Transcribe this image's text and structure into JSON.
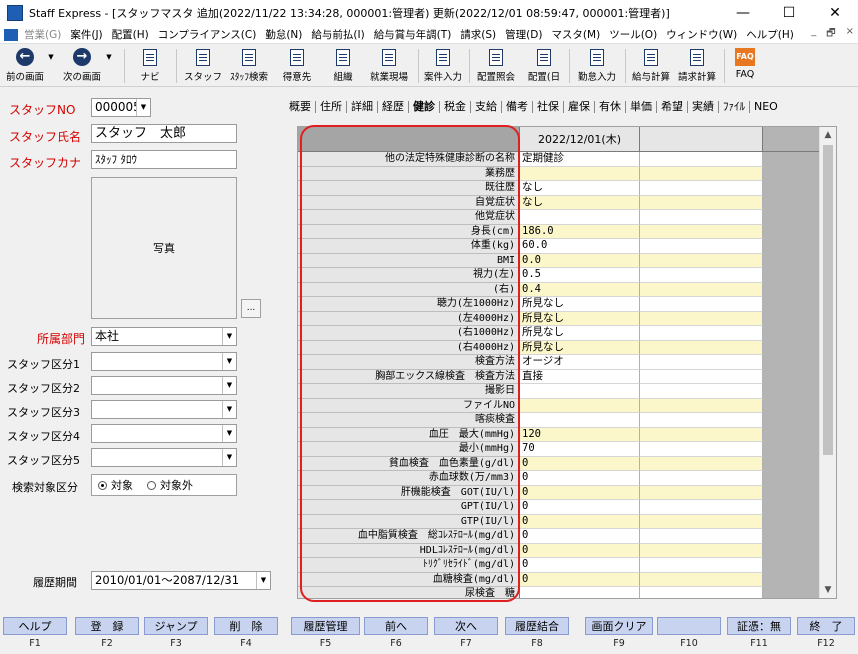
{
  "window": {
    "title": "Staff Express - [スタッフマスタ 追加(2022/11/22 13:34:28, 000001:管理者) 更新(2022/12/01 08:59:47, 000001:管理者)]",
    "minimize": "—",
    "maximize": "☐",
    "close": "✕"
  },
  "menu": [
    {
      "label": "営業(G)",
      "dim": true
    },
    {
      "label": "案件(J)",
      "dim": false
    },
    {
      "label": "配置(H)",
      "dim": false
    },
    {
      "label": "コンプライアンス(C)",
      "dim": false
    },
    {
      "label": "勤怠(N)",
      "dim": false
    },
    {
      "label": "給与前払(I)",
      "dim": false
    },
    {
      "label": "給与賞与年調(T)",
      "dim": false
    },
    {
      "label": "請求(S)",
      "dim": false
    },
    {
      "label": "管理(D)",
      "dim": false
    },
    {
      "label": "マスタ(M)",
      "dim": false
    },
    {
      "label": "ツール(O)",
      "dim": false
    },
    {
      "label": "ウィンドウ(W)",
      "dim": false
    },
    {
      "label": "ヘルプ(H)",
      "dim": false
    }
  ],
  "mdi_controls": [
    "_",
    "🗗",
    "×"
  ],
  "toolbar": [
    {
      "label": "前の画面",
      "icon": "back-arrow-icon"
    },
    {
      "label": "次の画面",
      "icon": "forward-arrow-icon"
    },
    {
      "label": "ナビ",
      "icon": "navi-icon"
    },
    {
      "label": "スタッフ",
      "icon": "staff-icon"
    },
    {
      "label": "ｽﾀｯﾌ検索",
      "icon": "staff-search-icon"
    },
    {
      "label": "得意先",
      "icon": "customer-icon"
    },
    {
      "label": "組織",
      "icon": "organization-icon"
    },
    {
      "label": "就業現場",
      "icon": "worksite-icon"
    },
    {
      "label": "案件入力",
      "icon": "project-input-icon"
    },
    {
      "label": "配置照会",
      "icon": "placement-inquiry-icon"
    },
    {
      "label": "配置(日",
      "icon": "placement-daily-icon"
    },
    {
      "label": "勤怠入力",
      "icon": "attendance-input-icon"
    },
    {
      "label": "給与計算",
      "icon": "payroll-calc-icon"
    },
    {
      "label": "請求計算",
      "icon": "billing-calc-icon"
    },
    {
      "label": "FAQ",
      "icon": "faq-icon"
    }
  ],
  "left": {
    "staff_no_label": "スタッフNO",
    "staff_no_value": "000005",
    "staff_name_label": "スタッフ氏名",
    "staff_name_value": "スタッフ　太郎",
    "staff_kana_label": "スタッフカナ",
    "staff_kana_value": "ｽﾀｯﾌ ﾀﾛｳ",
    "photo_label": "写真",
    "photo_button": "...",
    "dept_label": "所属部門",
    "dept_value": "本社",
    "class1_label": "スタッフ区分1",
    "class2_label": "スタッフ区分2",
    "class3_label": "スタッフ区分3",
    "class4_label": "スタッフ区分4",
    "class5_label": "スタッフ区分5",
    "search_label": "検索対象区分",
    "radio_on": "対象",
    "radio_off": "対象外",
    "history_label": "履歴期間",
    "history_value": "2010/01/01～2087/12/31"
  },
  "tabs": [
    "概要",
    "住所",
    "詳細",
    "経歴",
    "健診",
    "税金",
    "支給",
    "備考",
    "社保",
    "雇保",
    "有休",
    "単価",
    "希望",
    "実績",
    "ﾌｧｲﾙ",
    "NEO"
  ],
  "active_tab": "健診",
  "grid": {
    "column_date": "2022/12/01(木)",
    "rows": [
      {
        "label": "他の法定特殊健康診断の名称",
        "value": "定期健診"
      },
      {
        "label": "業務歴",
        "value": ""
      },
      {
        "label": "既往歴",
        "value": "なし"
      },
      {
        "label": "自覚症状",
        "value": "なし"
      },
      {
        "label": "他覚症状",
        "value": ""
      },
      {
        "label": "身長(cm)",
        "value": "186.0"
      },
      {
        "label": "体重(kg)",
        "value": "60.0"
      },
      {
        "label": "BMI",
        "value": "0.0"
      },
      {
        "label": "視力(左)",
        "value": "0.5"
      },
      {
        "label": "(右)",
        "value": "0.4"
      },
      {
        "label": "聴力(左1000Hz)",
        "value": "所見なし"
      },
      {
        "label": "(左4000Hz)",
        "value": "所見なし"
      },
      {
        "label": "(右1000Hz)",
        "value": "所見なし"
      },
      {
        "label": "(右4000Hz)",
        "value": "所見なし"
      },
      {
        "label": "検査方法",
        "value": "オージオ"
      },
      {
        "label": "胸部エックス線検査　検査方法",
        "value": "直接"
      },
      {
        "label": "撮影日",
        "value": ""
      },
      {
        "label": "ファイルNO",
        "value": ""
      },
      {
        "label": "喀痰検査",
        "value": ""
      },
      {
        "label": "血圧　最大(mmHg)",
        "value": "120"
      },
      {
        "label": "最小(mmHg)",
        "value": "70"
      },
      {
        "label": "貧血検査　血色素量(g/dl)",
        "value": "0"
      },
      {
        "label": "赤血球数(万/mm3)",
        "value": "0"
      },
      {
        "label": "肝機能検査　GOT(IU/l)",
        "value": "0"
      },
      {
        "label": "GPT(IU/l)",
        "value": "0"
      },
      {
        "label": "GTP(IU/l)",
        "value": "0"
      },
      {
        "label": "血中脂質検査　総ｺﾚｽﾃﾛｰﾙ(mg/dl)",
        "value": "0"
      },
      {
        "label": "HDLｺﾚｽﾃﾛｰﾙ(mg/dl)",
        "value": "0"
      },
      {
        "label": "ﾄﾘｸﾞﾘｾﾗｲﾄﾞ(mg/dl)",
        "value": "0"
      },
      {
        "label": "血糖検査(mg/dl)",
        "value": "0"
      },
      {
        "label": "尿検査　糖",
        "value": ""
      }
    ]
  },
  "fkeys": [
    {
      "label": "ヘルプ",
      "key": "F1"
    },
    {
      "label": "登　録",
      "key": "F2"
    },
    {
      "label": "ジャンプ",
      "key": "F3"
    },
    {
      "label": "削　除",
      "key": "F4"
    },
    {
      "label": "履歴管理",
      "key": "F5"
    },
    {
      "label": "前へ",
      "key": "F6"
    },
    {
      "label": "次へ",
      "key": "F7"
    },
    {
      "label": "履歴結合",
      "key": "F8"
    },
    {
      "label": "画面クリア",
      "key": "F9"
    },
    {
      "label": "",
      "key": "F10"
    },
    {
      "label": "証憑：無",
      "key": "F11"
    },
    {
      "label": "終　了",
      "key": "F12"
    }
  ],
  "colors": {
    "required_label": "#d40000",
    "highlight_border": "#e02020",
    "fkey_bg": "#c8d3f0",
    "cell_yellow": "#fbf7cb"
  }
}
